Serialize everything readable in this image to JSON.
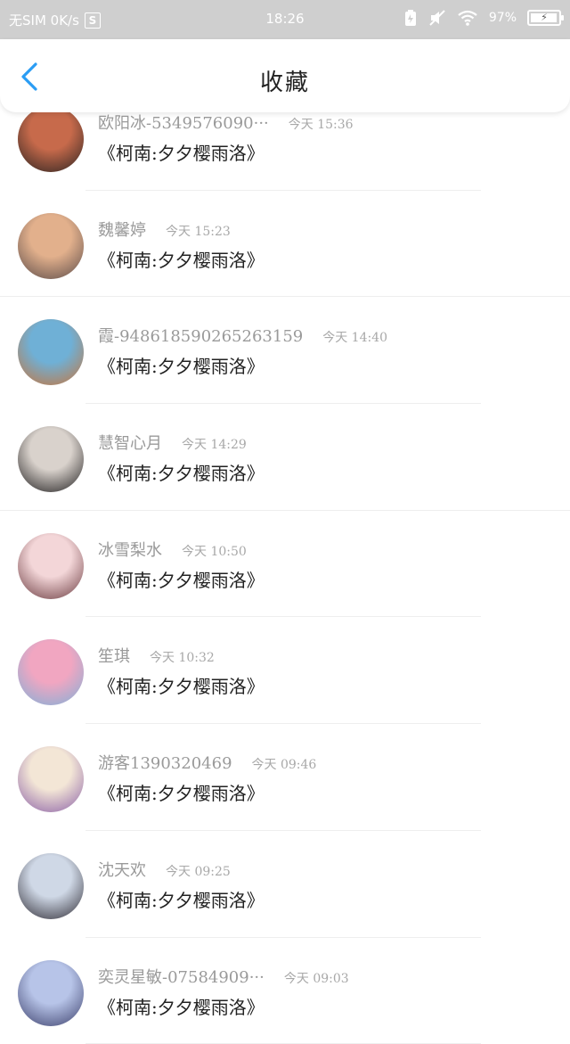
{
  "status_bar": {
    "carrier": "无SIM 0K/s",
    "s_badge": "S",
    "time": "18:26",
    "battery_percent": "97%",
    "battery_level": 0.97
  },
  "header": {
    "title": "收藏"
  },
  "items": [
    {
      "name": "欧阳冰-5349576090···",
      "time": "今天 15:36",
      "message": "《柯南:夕夕樱雨洛》",
      "avatar_color": [
        "#c76a4b",
        "#2a2321"
      ]
    },
    {
      "name": "魏馨婷",
      "time": "今天 15:23",
      "message": "《柯南:夕夕樱雨洛》",
      "avatar_color": [
        "#e2b08c",
        "#5a4a48"
      ]
    },
    {
      "name": "霞-948618590265263159",
      "time": "今天 14:40",
      "message": "《柯南:夕夕樱雨洛》",
      "avatar_color": [
        "#6fb0d6",
        "#c8743a"
      ]
    },
    {
      "name": "慧智心月",
      "time": "今天 14:29",
      "message": "《柯南:夕夕樱雨洛》",
      "avatar_color": [
        "#d9d2cc",
        "#1e1c1d"
      ]
    },
    {
      "name": "冰雪梨水",
      "time": "今天 10:50",
      "message": "《柯南:夕夕樱雨洛》",
      "avatar_color": [
        "#f3d6d8",
        "#6a3a3f"
      ]
    },
    {
      "name": "笙琪",
      "time": "今天 10:32",
      "message": "《柯南:夕夕樱雨洛》",
      "avatar_color": [
        "#f1a6c1",
        "#7fb0d8"
      ]
    },
    {
      "name": "游客1390320469",
      "time": "今天 09:46",
      "message": "《柯南:夕夕樱雨洛》",
      "avatar_color": [
        "#f3e6d6",
        "#8a5fa6"
      ]
    },
    {
      "name": "沈天欢",
      "time": "今天 09:25",
      "message": "《柯南:夕夕樱雨洛》",
      "avatar_color": [
        "#cfd8e6",
        "#2d2a33"
      ]
    },
    {
      "name": "奕灵星敏-07584909···",
      "time": "今天 09:03",
      "message": "《柯南:夕夕樱雨洛》",
      "avatar_color": [
        "#b7c4e8",
        "#3b3f6b"
      ]
    }
  ]
}
